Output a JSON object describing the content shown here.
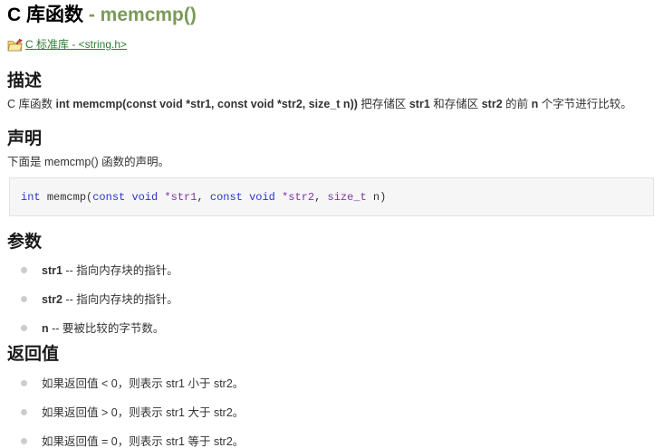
{
  "title": {
    "main": "C 库函数 ",
    "function": "- memcmp()"
  },
  "breadcrumb": {
    "icon": "folder-up-arrow-icon",
    "link_label": "C 标准库 - <string.h>"
  },
  "description": {
    "heading": "描述",
    "pre": "C 库函数 ",
    "signature": "int memcmp(const void *str1, const void *str2, size_t n))",
    "mid1": " 把存储区 ",
    "term1": "str1",
    "mid2": " 和存储区 ",
    "term2": "str2",
    "mid3": " 的前 ",
    "term3": "n",
    "post": " 个字节进行比较。"
  },
  "declaration": {
    "heading": "声明",
    "intro": "下面是 memcmp() 函数的声明。",
    "code": {
      "k1": "int ",
      "f1": "memcmp(",
      "k2": "const void ",
      "v1": "*str1",
      "s1": ", ",
      "k3": "const void ",
      "v2": "*str2",
      "s2": ", ",
      "v3": "size_t",
      "e1": " n)"
    }
  },
  "params": {
    "heading": "参数",
    "items": [
      {
        "term": "str1",
        "desc": " -- 指向内存块的指针。"
      },
      {
        "term": "str2",
        "desc": " -- 指向内存块的指针。"
      },
      {
        "term": "n",
        "desc": " -- 要被比较的字节数。"
      }
    ]
  },
  "returns": {
    "heading": "返回值",
    "items": [
      "如果返回值 < 0，则表示 str1 小于 str2。",
      "如果返回值 > 0，则表示 str1 大于 str2。",
      "如果返回值 = 0，则表示 str1 等于 str2。"
    ]
  },
  "colors": {
    "title_function_green": "#7a9a58",
    "link_green": "#2e7d32",
    "code_keyword_blue": "#2b35c7",
    "code_type_purple": "#8135a8",
    "code_background": "#f6f6f7",
    "code_border": "#e1e1e8",
    "body_text": "#333333",
    "bullet_gray": "#cccccc"
  }
}
